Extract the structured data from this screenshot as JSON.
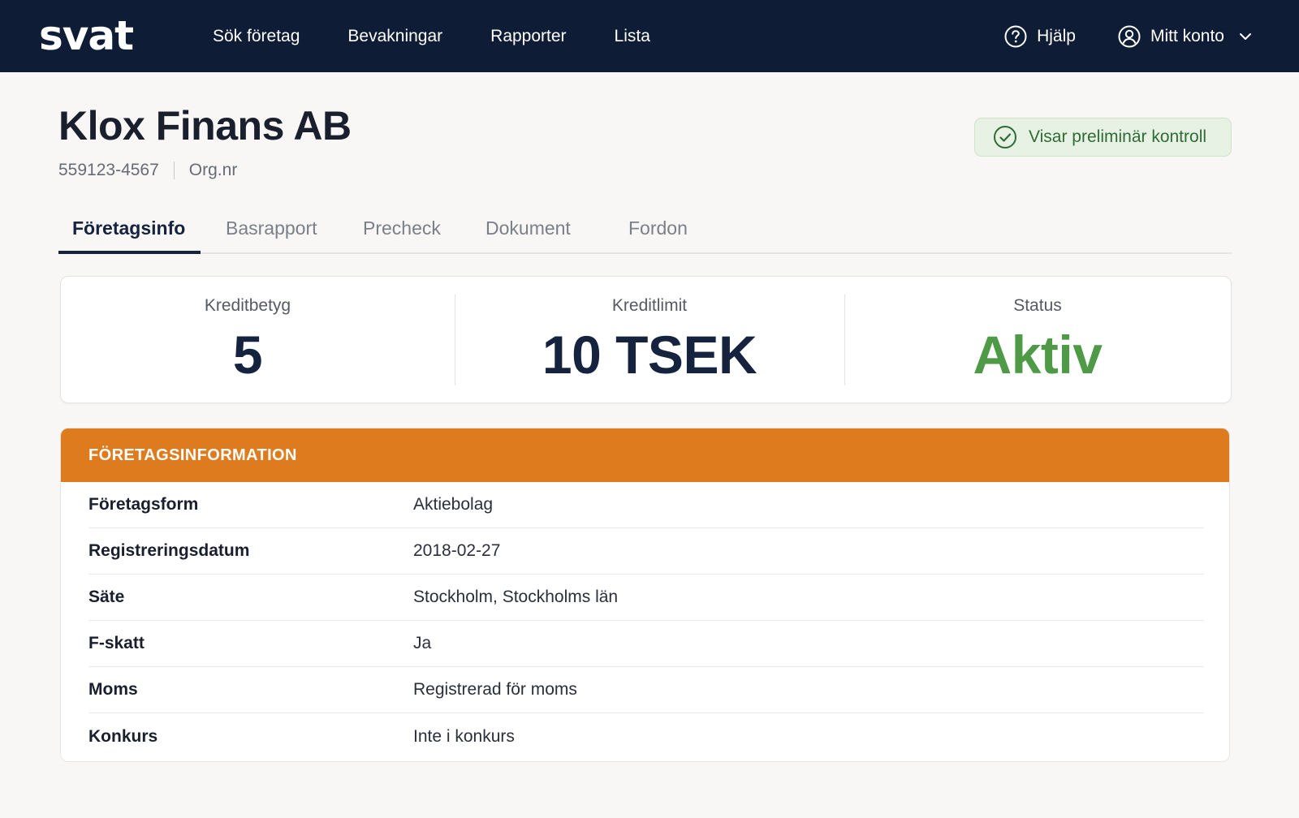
{
  "app": {
    "logo": "svat"
  },
  "nav": {
    "items": [
      "Sök företag",
      "Bevakningar",
      "Rapporter",
      "Lista"
    ],
    "help_label": "Hjälp",
    "account_label": "Mitt konto",
    "icons": {
      "help": "help-circle-icon",
      "account": "user-circle-icon",
      "chevron": "chevron-down-icon"
    }
  },
  "company": {
    "name": "Klox Finans AB",
    "org_number": "559123-4567",
    "org_label": "Org.nr"
  },
  "badge": {
    "label": "Visar preliminär kontroll",
    "icon": "check-circle-icon",
    "color": "#2f6b35"
  },
  "tabs": [
    {
      "label": "Företagsinfo",
      "active": true
    },
    {
      "label": "Basrapport",
      "active": false
    },
    {
      "label": "Precheck",
      "active": false
    },
    {
      "label": "Dokument",
      "active": false
    },
    {
      "label": "Fordon",
      "active": false
    }
  ],
  "summary": {
    "metrics": [
      {
        "label": "Kreditbetyg",
        "value": "5"
      },
      {
        "label": "Kreditlimit",
        "value": "10 TSEK"
      },
      {
        "label": "Status",
        "value": "Aktiv",
        "color": "#4e9a46"
      }
    ]
  },
  "info": {
    "header": "FÖRETAGSINFORMATION",
    "header_color": "#de7b1e",
    "rows": [
      {
        "key": "Företagsform",
        "value": "Aktiebolag"
      },
      {
        "key": "Registreringsdatum",
        "value": "2018-02-27"
      },
      {
        "key": "Säte",
        "value": "Stockholm, Stockholms län"
      },
      {
        "key": "F-skatt",
        "value": "Ja"
      },
      {
        "key": "Moms",
        "value": "Registrerad för moms"
      },
      {
        "key": "Konkurs",
        "value": "Inte i konkurs"
      }
    ]
  },
  "colors": {
    "navbar": "#0e1c36",
    "primary_text": "#15233f"
  }
}
